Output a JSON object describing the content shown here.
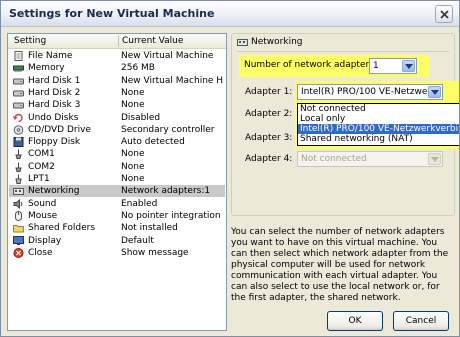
{
  "window": {
    "title": "Settings for New Virtual Machine"
  },
  "list": {
    "columns": {
      "setting": "Setting",
      "value": "Current Value"
    },
    "rows": [
      {
        "icon": "file-icon",
        "name": "File Name",
        "value": "New Virtual Machine"
      },
      {
        "icon": "memory-icon",
        "name": "Memory",
        "value": "256 MB"
      },
      {
        "icon": "hard-disk-icon",
        "name": "Hard Disk 1",
        "value": "New Virtual Machine Ha..."
      },
      {
        "icon": "hard-disk-icon",
        "name": "Hard Disk 2",
        "value": "None"
      },
      {
        "icon": "hard-disk-icon",
        "name": "Hard Disk 3",
        "value": "None"
      },
      {
        "icon": "undo-icon",
        "name": "Undo Disks",
        "value": "Disabled"
      },
      {
        "icon": "cd-dvd-icon",
        "name": "CD/DVD Drive",
        "value": "Secondary controller"
      },
      {
        "icon": "floppy-icon",
        "name": "Floppy Disk",
        "value": "Auto detected"
      },
      {
        "icon": "serial-port-icon",
        "name": "COM1",
        "value": "None"
      },
      {
        "icon": "serial-port-icon",
        "name": "COM2",
        "value": "None"
      },
      {
        "icon": "printer-port-icon",
        "name": "LPT1",
        "value": "None"
      },
      {
        "icon": "network-icon",
        "name": "Networking",
        "value": "Network adapters:1"
      },
      {
        "icon": "sound-icon",
        "name": "Sound",
        "value": "Enabled"
      },
      {
        "icon": "mouse-icon",
        "name": "Mouse",
        "value": "No pointer integration"
      },
      {
        "icon": "folder-icon",
        "name": "Shared Folders",
        "value": "Not installed"
      },
      {
        "icon": "display-icon",
        "name": "Display",
        "value": "Default"
      },
      {
        "icon": "close-action-icon",
        "name": "Close",
        "value": "Show message"
      }
    ],
    "selected_index": 11
  },
  "networking": {
    "header": "Networking",
    "count_label": "Number of network adapters:",
    "count_value": "1",
    "adapters": [
      {
        "label": "Adapter 1:",
        "value": "Intel(R) PRO/100 VE-Netzwerkve",
        "enabled": true
      },
      {
        "label": "Adapter 2:",
        "value": "",
        "enabled": false
      },
      {
        "label": "Adapter 3:",
        "value": "",
        "enabled": false
      },
      {
        "label": "Adapter 4:",
        "value": "Not connected",
        "enabled": false
      }
    ],
    "dropdown_options": [
      "Not connected",
      "Local only",
      "Intel(R) PRO/100 VE-Netzwerkverbindung",
      "Shared networking (NAT)"
    ],
    "dropdown_selected": 2,
    "description": "You can select the number of network adapters you want to have on this virtual machine. You can then select which network adapter from the physical computer will be used for network communication with each virtual adapter. You can also select to use the local network or, for the first adapter, the shared network."
  },
  "buttons": {
    "ok": "OK",
    "cancel": "Cancel"
  },
  "colors": {
    "highlight": "#ffff66",
    "selection": "#316ac5",
    "list_selected": "#c9c9c9"
  }
}
